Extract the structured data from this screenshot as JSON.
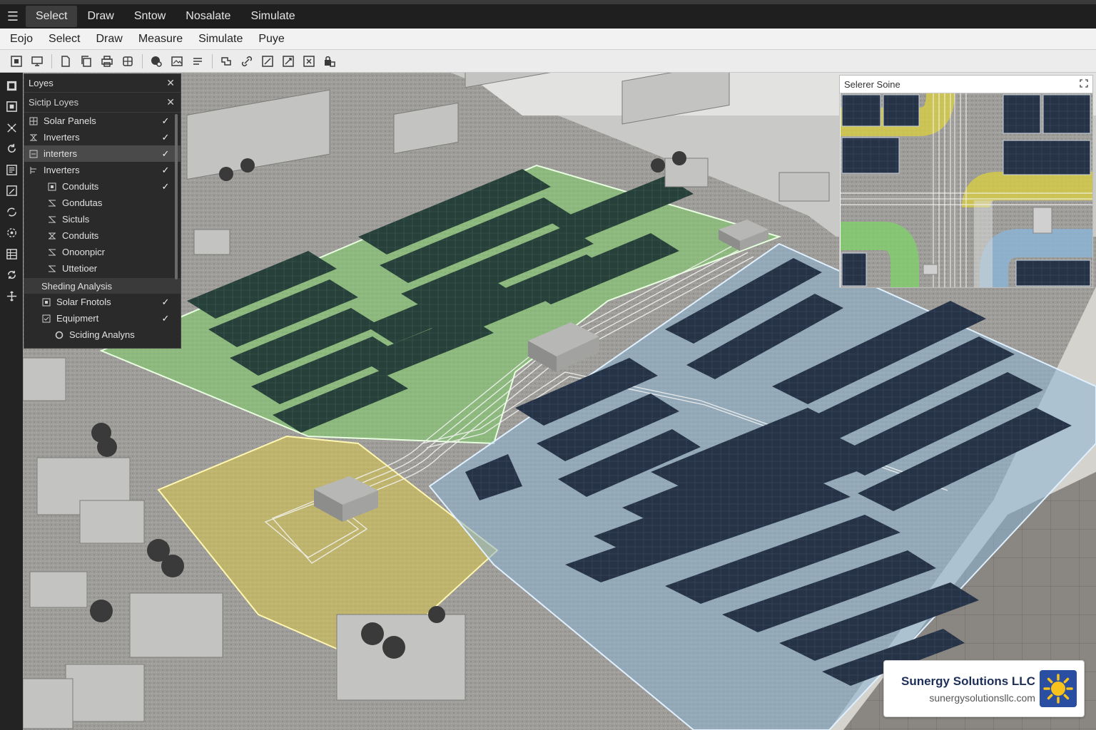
{
  "topbar": {
    "items": [
      "Select",
      "Draw",
      "Sntow",
      "Nosalate",
      "Simulate"
    ]
  },
  "menubar": {
    "items": [
      "Eojo",
      "Select",
      "Draw",
      "Measure",
      "Simulate",
      "Puye"
    ]
  },
  "layers_panel": {
    "title": "Loyes",
    "subtitle": "Sictip Loyes",
    "items": [
      {
        "label": "Solar Panels",
        "checked": true,
        "icon": "solar-grid-icon"
      },
      {
        "label": "Inverters",
        "checked": true,
        "icon": "inverter-icon"
      },
      {
        "label": "interters",
        "checked": true,
        "icon": "inverter-icon"
      },
      {
        "label": "Inverters",
        "checked": true,
        "icon": "tree-icon"
      },
      {
        "label": "Conduits",
        "checked": true,
        "icon": "box-icon"
      },
      {
        "label": "Gondutas",
        "checked": false,
        "icon": "conduit-icon"
      },
      {
        "label": "Sictuls",
        "checked": false,
        "icon": "conduit-icon"
      },
      {
        "label": "Conduits",
        "checked": false,
        "icon": "conduit-icon"
      },
      {
        "label": "Onoonpicr",
        "checked": false,
        "icon": "conduit-icon"
      },
      {
        "label": "Uttetioer",
        "checked": false,
        "icon": "conduit-icon"
      }
    ],
    "section_label": "Sheding Analysis",
    "section_items": [
      {
        "label": "Solar Fnotols",
        "checked": true,
        "icon": "box-icon"
      },
      {
        "label": "Equipmert",
        "checked": true,
        "icon": "equipment-icon"
      },
      {
        "label": "Sciding Analyns",
        "checked": false,
        "icon": "circle-icon"
      }
    ]
  },
  "minimap": {
    "title": "Selerer Soine"
  },
  "brand": {
    "name": "Sunergy Solutions LLC",
    "url": "sunergysolutionsllc.com"
  },
  "colors": {
    "zone_green": "#7fcf6a",
    "zone_blue": "#8db4d4",
    "zone_yellow": "#d9c84a",
    "panel_dark": "#243042",
    "roof": "#9b9a96"
  }
}
